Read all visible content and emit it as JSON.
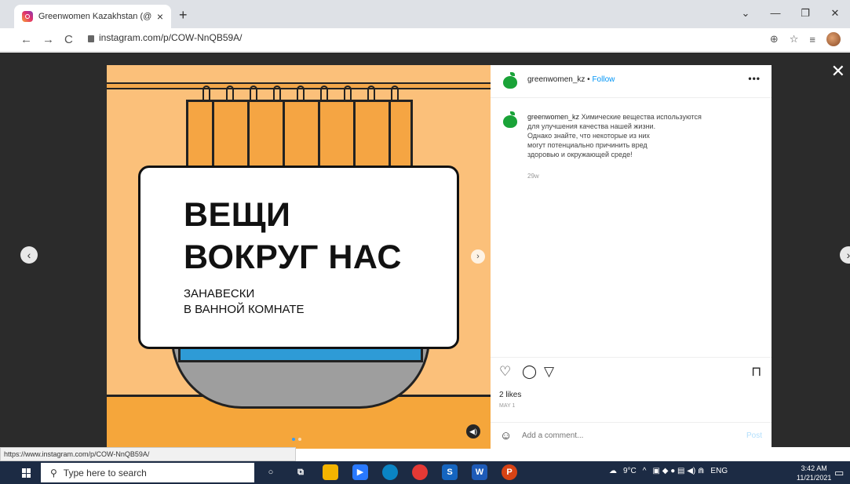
{
  "browser": {
    "tab_title": "Greenwomen Kazakhstan (@gree",
    "tab_close": "×",
    "new_tab": "+",
    "back": "←",
    "forward": "→",
    "reload": "C",
    "url": "instagram.com/p/COW-NnQB59A/",
    "win_min": "—",
    "win_max": "❐",
    "win_close": "✕",
    "chevron": "⌄"
  },
  "overlay": {
    "close": "✕",
    "prev": "‹",
    "next": "›"
  },
  "post": {
    "heading_line1": "ВЕЩИ",
    "heading_line2": "ВОКРУГ НАС",
    "subheading_line1": "ЗАНАВЕСКИ",
    "subheading_line2": "В ВАННОЙ КОМНАТЕ",
    "image_next": "›",
    "mute": "◀)"
  },
  "panel": {
    "username": "greenwomen_kz",
    "separator": "•",
    "follow": "Follow",
    "more": "•••",
    "caption_user": "greenwomen_kz",
    "caption_line1": "Химические вещества используются",
    "caption_line2": "для улучшения качества нашей жизни.",
    "caption_line3": "Однако знайте, что некоторые из них",
    "caption_line4": "могут потенциально причинить вред",
    "caption_line5": "здоровью и окружающей среде!",
    "age": "29w",
    "likes": "2 likes",
    "date": "MAY 1",
    "comment_placeholder": "Add a comment...",
    "post_btn": "Post"
  },
  "status_url": "https://www.instagram.com/p/COW-NnQB59A/",
  "taskbar": {
    "search_placeholder": "Type here to search",
    "weather": "9°C",
    "lang": "ENG",
    "time": "3:42 AM",
    "date": "11/21/2021"
  },
  "colors": {
    "accent": "#0095f6",
    "brand_green": "#1aa338",
    "post_bg": "#fbc07a"
  }
}
